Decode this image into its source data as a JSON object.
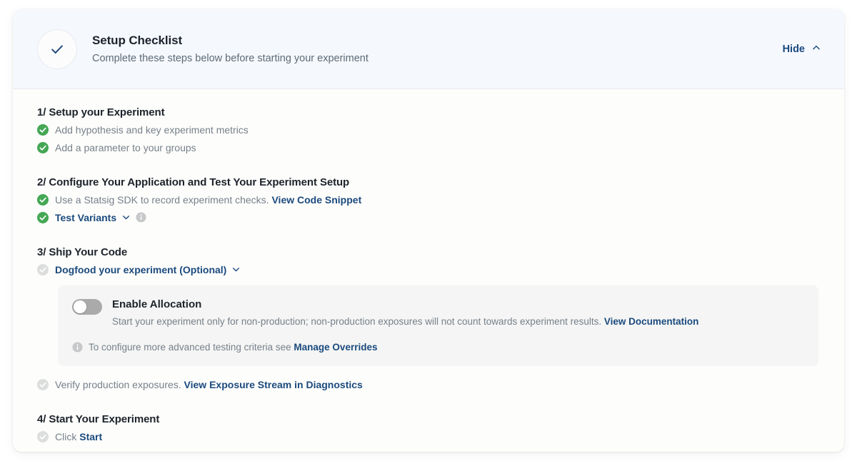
{
  "header": {
    "icon": "check-circle-icon",
    "title": "Setup Checklist",
    "subtitle": "Complete these steps below before starting your experiment",
    "hide_label": "Hide",
    "hide_icon": "chevron-up-icon"
  },
  "colors": {
    "accent_link": "#1b4a7e",
    "check_done": "#44a754",
    "check_pending": "#dcdedd",
    "panel_bg": "#f4f5f4",
    "header_bg": "#f5f8fd",
    "card_bg": "#fdfdfb"
  },
  "sections": [
    {
      "title": "1/ Setup your Experiment",
      "steps": [
        {
          "state": "done",
          "text": "Add hypothesis and key experiment metrics"
        },
        {
          "state": "done",
          "text": "Add a parameter to your groups"
        }
      ]
    },
    {
      "title": "2/ Configure Your Application and Test Your Experiment Setup",
      "steps": [
        {
          "state": "done",
          "text": "Use a Statsig SDK to record experiment checks.",
          "link": "View Code Snippet"
        },
        {
          "state": "done",
          "link_text": "Test Variants",
          "chevron": "chevron-down-icon",
          "info": "info-icon"
        }
      ]
    },
    {
      "title": "3/ Ship Your Code",
      "steps": [
        {
          "state": "pending",
          "link_text": "Dogfood your experiment (Optional)",
          "chevron": "chevron-down-icon"
        }
      ]
    },
    {
      "title": "4/ Start Your Experiment",
      "steps": [
        {
          "state": "pending",
          "text": "Click",
          "link": "Start"
        }
      ]
    }
  ],
  "allocation_panel": {
    "toggle_state": "off",
    "toggle_label": "Enable Allocation",
    "description": "Start your experiment only for non-production; non-production exposures will not count towards experiment results.",
    "description_link": "View Documentation",
    "note_icon": "info-icon",
    "note_text": "To configure more advanced testing criteria see",
    "note_link": "Manage Overrides"
  },
  "verify_step": {
    "state": "pending",
    "text": "Verify production exposures.",
    "link": "View Exposure Stream in Diagnostics"
  }
}
